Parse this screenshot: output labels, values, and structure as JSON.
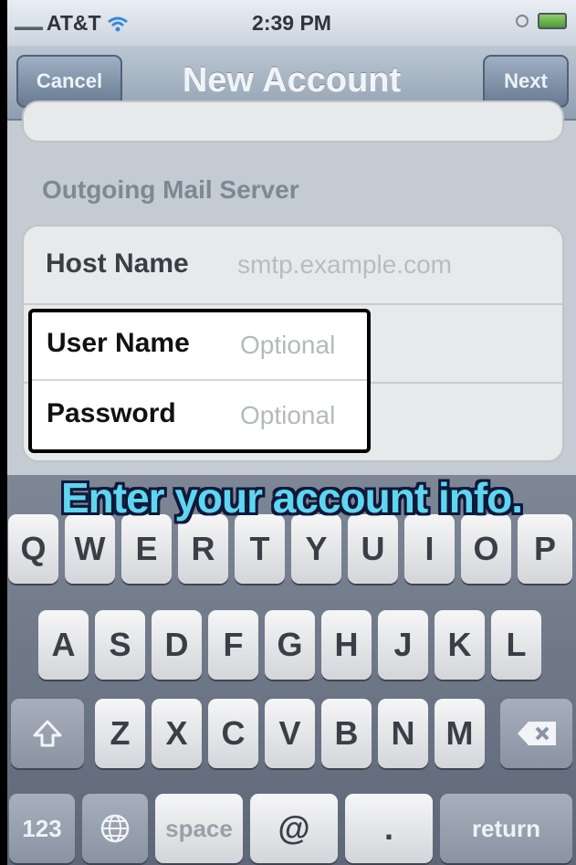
{
  "status_bar": {
    "carrier": "AT&T",
    "time": "2:39 PM"
  },
  "nav_bar": {
    "cancel_label": "Cancel",
    "title": "New Account",
    "next_label": "Next"
  },
  "section": {
    "title": "Outgoing Mail Server",
    "fields": [
      {
        "label": "Host Name",
        "placeholder": "smtp.example.com"
      },
      {
        "label": "User Name",
        "placeholder": "Optional"
      },
      {
        "label": "Password",
        "placeholder": "Optional"
      }
    ]
  },
  "annotation": "Enter your account info.",
  "keyboard": {
    "row1": [
      "Q",
      "W",
      "E",
      "R",
      "T",
      "Y",
      "U",
      "I",
      "O",
      "P"
    ],
    "row2": [
      "A",
      "S",
      "D",
      "F",
      "G",
      "H",
      "J",
      "K",
      "L"
    ],
    "row3": [
      "Z",
      "X",
      "C",
      "V",
      "B",
      "N",
      "M"
    ],
    "numbers_label": "123",
    "space_label": "space",
    "at_label": "@",
    "dot_label": ".",
    "return_label": "return",
    "icons": {
      "shift": "shift-arrow-icon",
      "delete": "backspace-icon",
      "globe": "globe-icon"
    }
  }
}
